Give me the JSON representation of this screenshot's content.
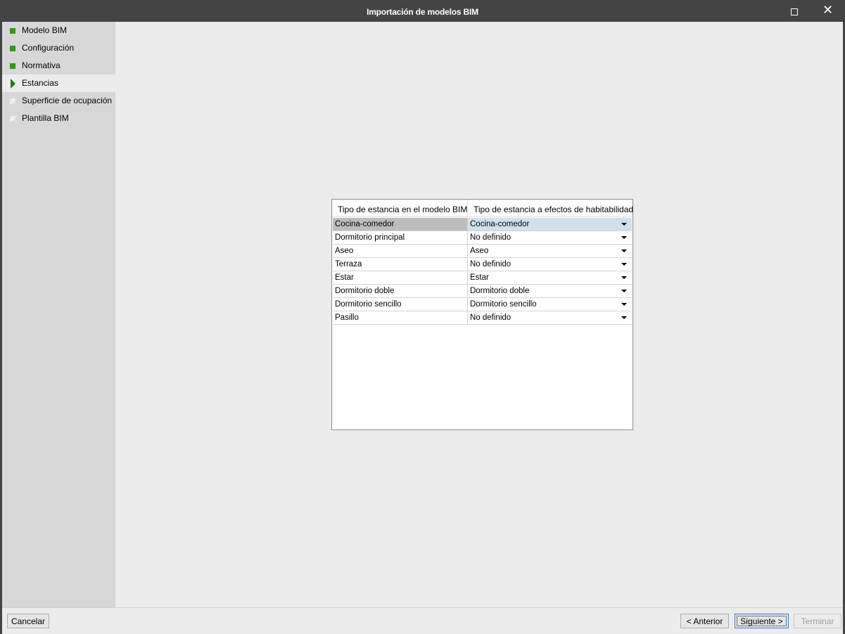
{
  "window": {
    "title": "Importación de modelos BIM"
  },
  "steps": [
    {
      "label": "Modelo BIM",
      "state": "done"
    },
    {
      "label": "Configuración",
      "state": "done"
    },
    {
      "label": "Normativa",
      "state": "done"
    },
    {
      "label": "Estancias",
      "state": "current"
    },
    {
      "label": "Superficie de ocupación",
      "state": "pending"
    },
    {
      "label": "Plantilla BIM",
      "state": "pending"
    }
  ],
  "table": {
    "headers": [
      "Tipo de estancia en el modelo BIM",
      "Tipo de estancia a efectos de habitabilidad"
    ],
    "rows": [
      {
        "bim": "Cocina-comedor",
        "habitabilidad": "Cocina-comedor",
        "selected": true
      },
      {
        "bim": "Dormitorio principal",
        "habitabilidad": "No definido"
      },
      {
        "bim": "Aseo",
        "habitabilidad": "Aseo"
      },
      {
        "bim": "Terraza",
        "habitabilidad": "No definido"
      },
      {
        "bim": "Estar",
        "habitabilidad": "Estar"
      },
      {
        "bim": "Dormitorio doble",
        "habitabilidad": "Dormitorio doble"
      },
      {
        "bim": "Dormitorio sencillo",
        "habitabilidad": "Dormitorio sencillo"
      },
      {
        "bim": "Pasillo",
        "habitabilidad": "No definido"
      }
    ]
  },
  "footer": {
    "cancel_label": "Cancelar",
    "prev_label": "< Anterior",
    "next_label": "Siguiente >",
    "finish_label": "Terminar",
    "finish_enabled": false
  },
  "colors": {
    "titlebar": "#444444",
    "step_done": "#2e9a16",
    "selected_cell": "#cfe1ec"
  },
  "icons": {
    "maximize": "maximize-icon",
    "close": "close-icon",
    "dropdown": "chevron-down-icon"
  }
}
